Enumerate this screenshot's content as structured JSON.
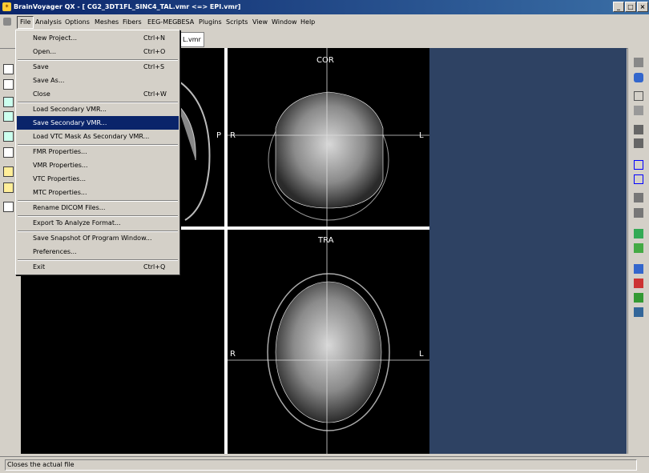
{
  "window": {
    "title": "BrainVoyager QX - [ CG2_3DT1FL_SINC4_TAL.vmr  <=> EPI.vmr]",
    "minimize": "_",
    "maximize": "□",
    "close": "×"
  },
  "menubar": {
    "items": [
      "File",
      "Analysis",
      "Options",
      "Meshes",
      "Fibers",
      "EEG-MEG",
      "BESA",
      "Plugins",
      "Scripts",
      "View",
      "Window",
      "Help"
    ],
    "mdi_controls": [
      "_",
      "▫",
      "×"
    ]
  },
  "tab": {
    "label": "L.vmr"
  },
  "file_menu": {
    "items": [
      {
        "label": "New Project...",
        "shortcut": "Ctrl+N"
      },
      {
        "label": "Open...",
        "shortcut": "Ctrl+O"
      },
      {
        "label": "Save",
        "shortcut": "Ctrl+S"
      },
      {
        "label": "Save As...",
        "shortcut": ""
      },
      {
        "label": "Close",
        "shortcut": "Ctrl+W"
      },
      {
        "label": "Load Secondary VMR...",
        "shortcut": ""
      },
      {
        "label": "Save Secondary VMR...",
        "shortcut": ""
      },
      {
        "label": "Load VTC Mask As Secondary VMR...",
        "shortcut": ""
      },
      {
        "label": "FMR Properties...",
        "shortcut": ""
      },
      {
        "label": "VMR Properties...",
        "shortcut": ""
      },
      {
        "label": "VTC Properties...",
        "shortcut": ""
      },
      {
        "label": "MTC Properties...",
        "shortcut": ""
      },
      {
        "label": "Rename DICOM Files...",
        "shortcut": ""
      },
      {
        "label": "Export To Analyze Format...",
        "shortcut": ""
      },
      {
        "label": "Save Snapshot Of Program Window...",
        "shortcut": ""
      },
      {
        "label": "Preferences...",
        "shortcut": ""
      },
      {
        "label": "Exit",
        "shortcut": "Ctrl+Q"
      }
    ],
    "highlighted": "Save Secondary VMR..."
  },
  "views": {
    "coronal": {
      "label": "COR",
      "left": "R",
      "right": "L"
    },
    "transverse": {
      "label": "TRA",
      "left": "R",
      "right": "L"
    },
    "sagittal": {
      "right": "P"
    }
  },
  "status": {
    "text": "Closes the actual file"
  },
  "colors": {
    "title_bar": "#0a246a",
    "workspace": "#2e4263",
    "menu_highlight": "#0a246a"
  }
}
